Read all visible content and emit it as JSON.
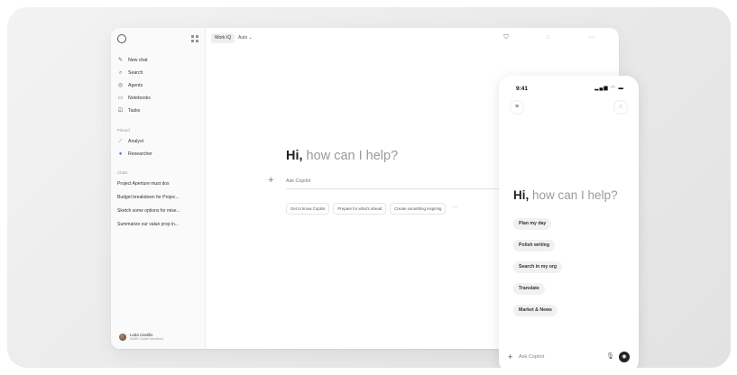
{
  "desktop": {
    "topbar": {
      "work_iq": "Work IQ",
      "auto": "Auto ⌄",
      "icons": [
        "shield-icon",
        "chat-icon",
        "more-icon"
      ]
    },
    "sidebar": {
      "nav": [
        {
          "icon": "new-chat-icon",
          "label": "New chat"
        },
        {
          "icon": "search-icon",
          "label": "Search"
        },
        {
          "icon": "agents-icon",
          "label": "Agents"
        },
        {
          "icon": "notebook-icon",
          "label": "Notebooks"
        },
        {
          "icon": "tasks-icon",
          "label": "Tasks"
        }
      ],
      "agents_label": "Pinned",
      "agents": [
        {
          "icon": "analyst-icon",
          "label": "Analyst"
        },
        {
          "icon": "researcher-icon",
          "label": "Researcher"
        }
      ],
      "chats_label": "Chats",
      "chats": [
        "Project Aperture must dos",
        "Budget breakdown for Projec...",
        "Sketch some options for mise...",
        "Summarize our value prop in..."
      ],
      "user": {
        "name": "Leda Castillo",
        "subtitle": "M365 Copilot Members"
      }
    },
    "main": {
      "greeting_hi": "Hi,",
      "greeting_rest": " how can I help?",
      "input_placeholder": "Ask Copilot",
      "chips": [
        "Get to know Copilot",
        "Prepare for what's ahead",
        "Create something inspiring"
      ],
      "chip_more": "···"
    }
  },
  "phone": {
    "time": "9:41",
    "status": "▮ ◔ ▬",
    "greeting_hi": "Hi,",
    "greeting_rest": " how can I help?",
    "suggestions": [
      "Plan my day",
      "Polish writing",
      "Search in my org",
      "Translate",
      "Market & News"
    ],
    "input_placeholder": "Ask Copilot"
  }
}
